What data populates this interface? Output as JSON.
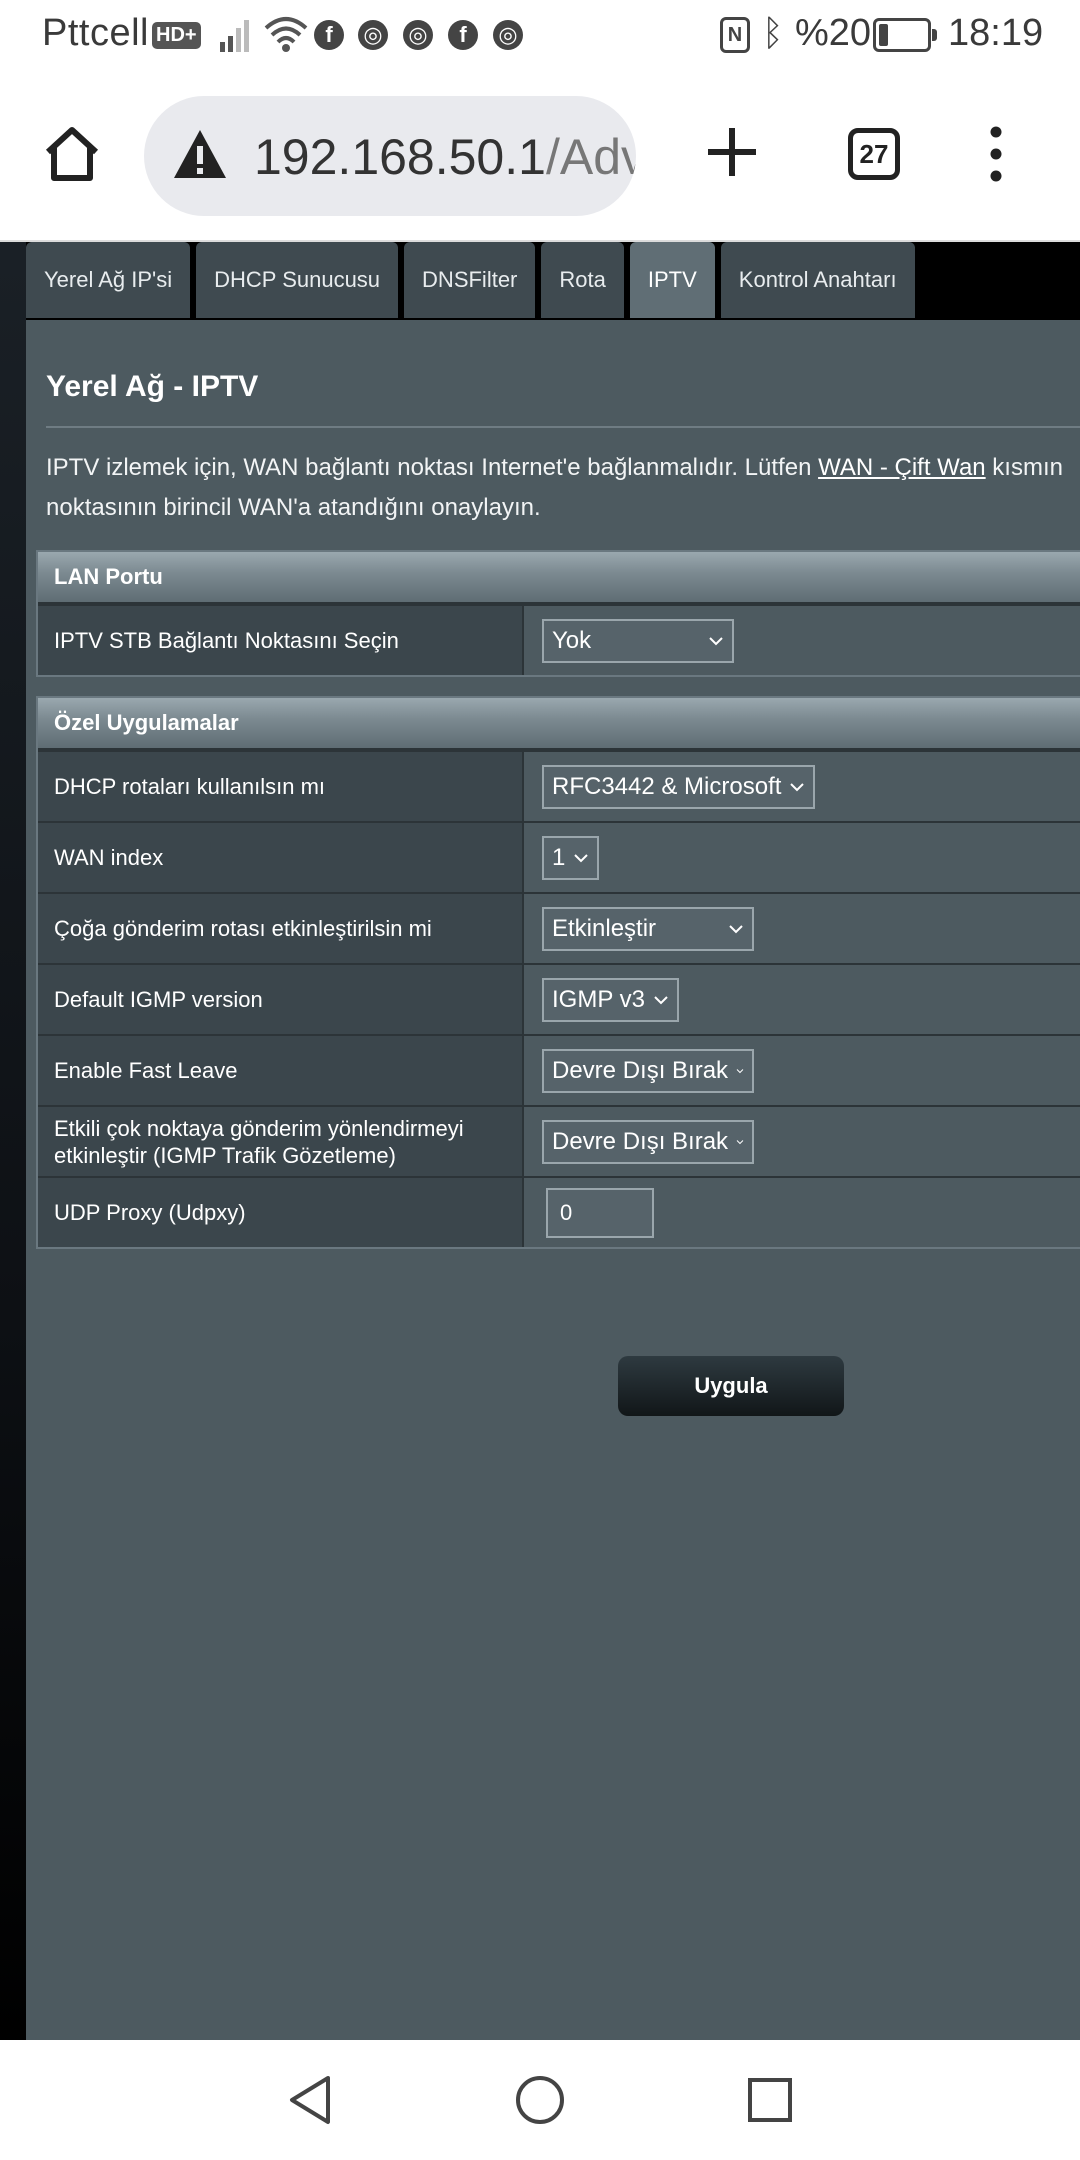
{
  "status_bar": {
    "carrier": "Pttcell",
    "hd_badge": "HD+",
    "app_icons": [
      "facebook-icon",
      "chrome-icon",
      "chrome-icon",
      "facebook-icon",
      "chrome-icon"
    ],
    "battery_percent_label": "%20",
    "battery_level": 0.2,
    "time": "18:19"
  },
  "browser": {
    "url_host": "192.168.50.1",
    "url_rest": "/Adv",
    "tab_count": "27"
  },
  "router": {
    "tabs": [
      {
        "label": "Yerel Ağ IP'si",
        "active": false
      },
      {
        "label": "DHCP Sunucusu",
        "active": false
      },
      {
        "label": "DNSFilter",
        "active": false
      },
      {
        "label": "Rota",
        "active": false
      },
      {
        "label": "IPTV",
        "active": true
      },
      {
        "label": "Kontrol Anahtarı",
        "active": false
      }
    ],
    "title": "Yerel Ağ - IPTV",
    "description": {
      "line1_before": "IPTV izlemek için, WAN bağlantı noktası Internet'e bağlanmalıdır. Lütfen ",
      "link": "WAN - Çift Wan",
      "line1_after": " kısmın",
      "line2": "noktasının birincil WAN'a atandığını onaylayın."
    },
    "lan_port": {
      "header": "LAN Portu",
      "rows": [
        {
          "label": "IPTV STB Bağlantı Noktasını Seçin",
          "value": "Yok"
        }
      ]
    },
    "special_apps": {
      "header": "Özel Uygulamalar",
      "rows": [
        {
          "label": "DHCP rotaları kullanılsın mı",
          "value": "RFC3442 & Microsoft"
        },
        {
          "label": "WAN index",
          "value": "1"
        },
        {
          "label": "Çoğa gönderim rotası etkinleştirilsin mi",
          "value": "Etkinleştir"
        },
        {
          "label": "Default IGMP version",
          "value": "IGMP v3"
        },
        {
          "label": "Enable Fast Leave",
          "value": "Devre Dışı Bırak"
        },
        {
          "label": "Etkili çok noktaya gönderim yönlendirmeyi etkinleştir (IGMP Trafik Gözetleme)",
          "value": "Devre Dışı Bırak"
        },
        {
          "label": "UDP Proxy (Udpxy)",
          "value": "0"
        }
      ]
    },
    "apply_label": "Uygula"
  },
  "navigation": {
    "icons": [
      "back-icon",
      "home-circle-icon",
      "recents-icon"
    ]
  }
}
